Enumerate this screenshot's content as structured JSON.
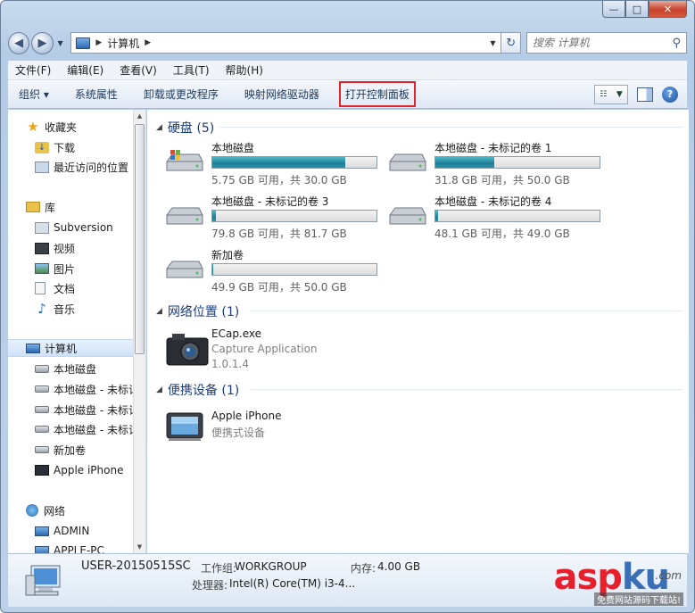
{
  "window": {
    "caption": {
      "minimize": "—",
      "maximize": "□",
      "close": "✕"
    }
  },
  "address": {
    "crumbs": [
      "计算机"
    ],
    "search_placeholder": "搜索 计算机"
  },
  "menu": [
    "文件(F)",
    "编辑(E)",
    "查看(V)",
    "工具(T)",
    "帮助(H)"
  ],
  "commands": {
    "organize": "组织 ▾",
    "system_properties": "系统属性",
    "uninstall": "卸载或更改程序",
    "map_drive": "映射网络驱动器",
    "control_panel": "打开控制面板"
  },
  "nav": {
    "favorites": "收藏夹",
    "downloads": "下载",
    "recent": "最近访问的位置",
    "libraries": "库",
    "subversion": "Subversion",
    "videos": "视频",
    "pictures": "图片",
    "documents": "文档",
    "music": "音乐",
    "computer": "计算机",
    "drive_c": "本地磁盘",
    "drive_1": "本地磁盘 - 未标记",
    "drive_2": "本地磁盘 - 未标记",
    "drive_3": "本地磁盘 - 未标记",
    "new_volume": "新加卷",
    "iphone": "Apple iPhone",
    "network": "网络",
    "admin": "ADMIN",
    "apple_pc": "APPLE-PC"
  },
  "groups": {
    "hdd": "硬盘 (5)",
    "netloc": "网络位置 (1)",
    "portable": "便携设备 (1)"
  },
  "drives": [
    {
      "name": "本地磁盘",
      "free": "5.75 GB 可用，共 30.0 GB",
      "used_fraction": 0.81
    },
    {
      "name": "本地磁盘 - 未标记的卷 1",
      "free": "31.8 GB 可用，共 50.0 GB",
      "used_fraction": 0.36
    },
    {
      "name": "本地磁盘 - 未标记的卷 3",
      "free": "79.8 GB 可用，共 81.7 GB",
      "used_fraction": 0.023
    },
    {
      "name": "本地磁盘 - 未标记的卷 4",
      "free": "48.1 GB 可用，共 49.0 GB",
      "used_fraction": 0.018
    },
    {
      "name": "新加卷",
      "free": "49.9 GB 可用，共 50.0 GB",
      "used_fraction": 0.002
    }
  ],
  "net_item": {
    "name": "ECap.exe",
    "desc": "Capture Application",
    "version": "1.0.1.4"
  },
  "portable_item": {
    "name": "Apple iPhone",
    "desc": "便携式设备"
  },
  "details": {
    "name": "USER-20150515SC",
    "workgroup_label": "工作组:",
    "workgroup": "WORKGROUP",
    "memory_label": "内存:",
    "memory": "4.00 GB",
    "cpu_label": "处理器:",
    "cpu": "Intel(R) Core(TM) i3-4..."
  },
  "watermark": {
    "brand_a": "asp",
    "brand_b": "ku",
    "com": ".com",
    "tagline": "免费网站源码下载站!"
  }
}
